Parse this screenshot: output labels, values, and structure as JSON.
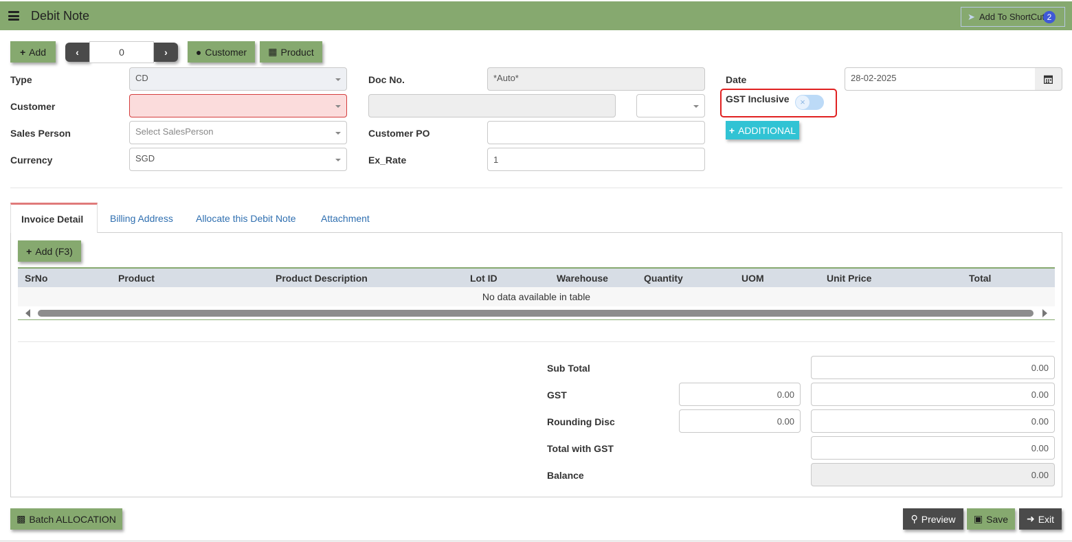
{
  "header": {
    "title": "Debit Note",
    "shortcut_label": "Add To ShortCut",
    "shortcut_count": "2"
  },
  "toolbar": {
    "add_label": "Add",
    "nav_value": "0",
    "customer_label": "Customer",
    "product_label": "Product"
  },
  "form": {
    "type_label": "Type",
    "type_value": "CD",
    "doc_no_label": "Doc No.",
    "doc_no_value": "*Auto*",
    "date_label": "Date",
    "date_value": "28-02-2025",
    "customer_label": "Customer",
    "customer_value": "",
    "gst_inclusive_label": "GST Inclusive",
    "gst_inclusive_on": false,
    "additional_label": "ADDITIONAL",
    "sales_person_label": "Sales Person",
    "sales_person_placeholder": "Select SalesPerson",
    "customer_po_label": "Customer PO",
    "customer_po_value": "",
    "currency_label": "Currency",
    "currency_value": "SGD",
    "ex_rate_label": "Ex_Rate",
    "ex_rate_value": "1"
  },
  "tabs": [
    {
      "label": "Invoice Detail",
      "active": true
    },
    {
      "label": "Billing Address",
      "active": false
    },
    {
      "label": "Allocate this Debit Note",
      "active": false
    },
    {
      "label": "Attachment",
      "active": false
    }
  ],
  "detail": {
    "add_label": "Add (F3)",
    "columns": [
      "SrNo",
      "Product",
      "Product Description",
      "Lot ID",
      "Warehouse",
      "Quantity",
      "UOM",
      "Unit Price",
      "Total"
    ],
    "empty_message": "No data available in table"
  },
  "totals": {
    "sub_total_label": "Sub Total",
    "sub_total_value": "0.00",
    "gst_label": "GST",
    "gst_rate_value": "0.00",
    "gst_value": "0.00",
    "rounding_label": "Rounding Disc",
    "rounding_rate_value": "0.00",
    "rounding_value": "0.00",
    "total_gst_label": "Total with GST",
    "total_gst_value": "0.00",
    "balance_label": "Balance",
    "balance_value": "0.00"
  },
  "footer": {
    "batch_label": "Batch ALLOCATION",
    "preview_label": "Preview",
    "save_label": "Save",
    "exit_label": "Exit"
  },
  "colors": {
    "header": "#86a96f",
    "error_field": "#fbdcdc",
    "additional": "#31c3d4",
    "dark_button": "#4a4a4a"
  }
}
